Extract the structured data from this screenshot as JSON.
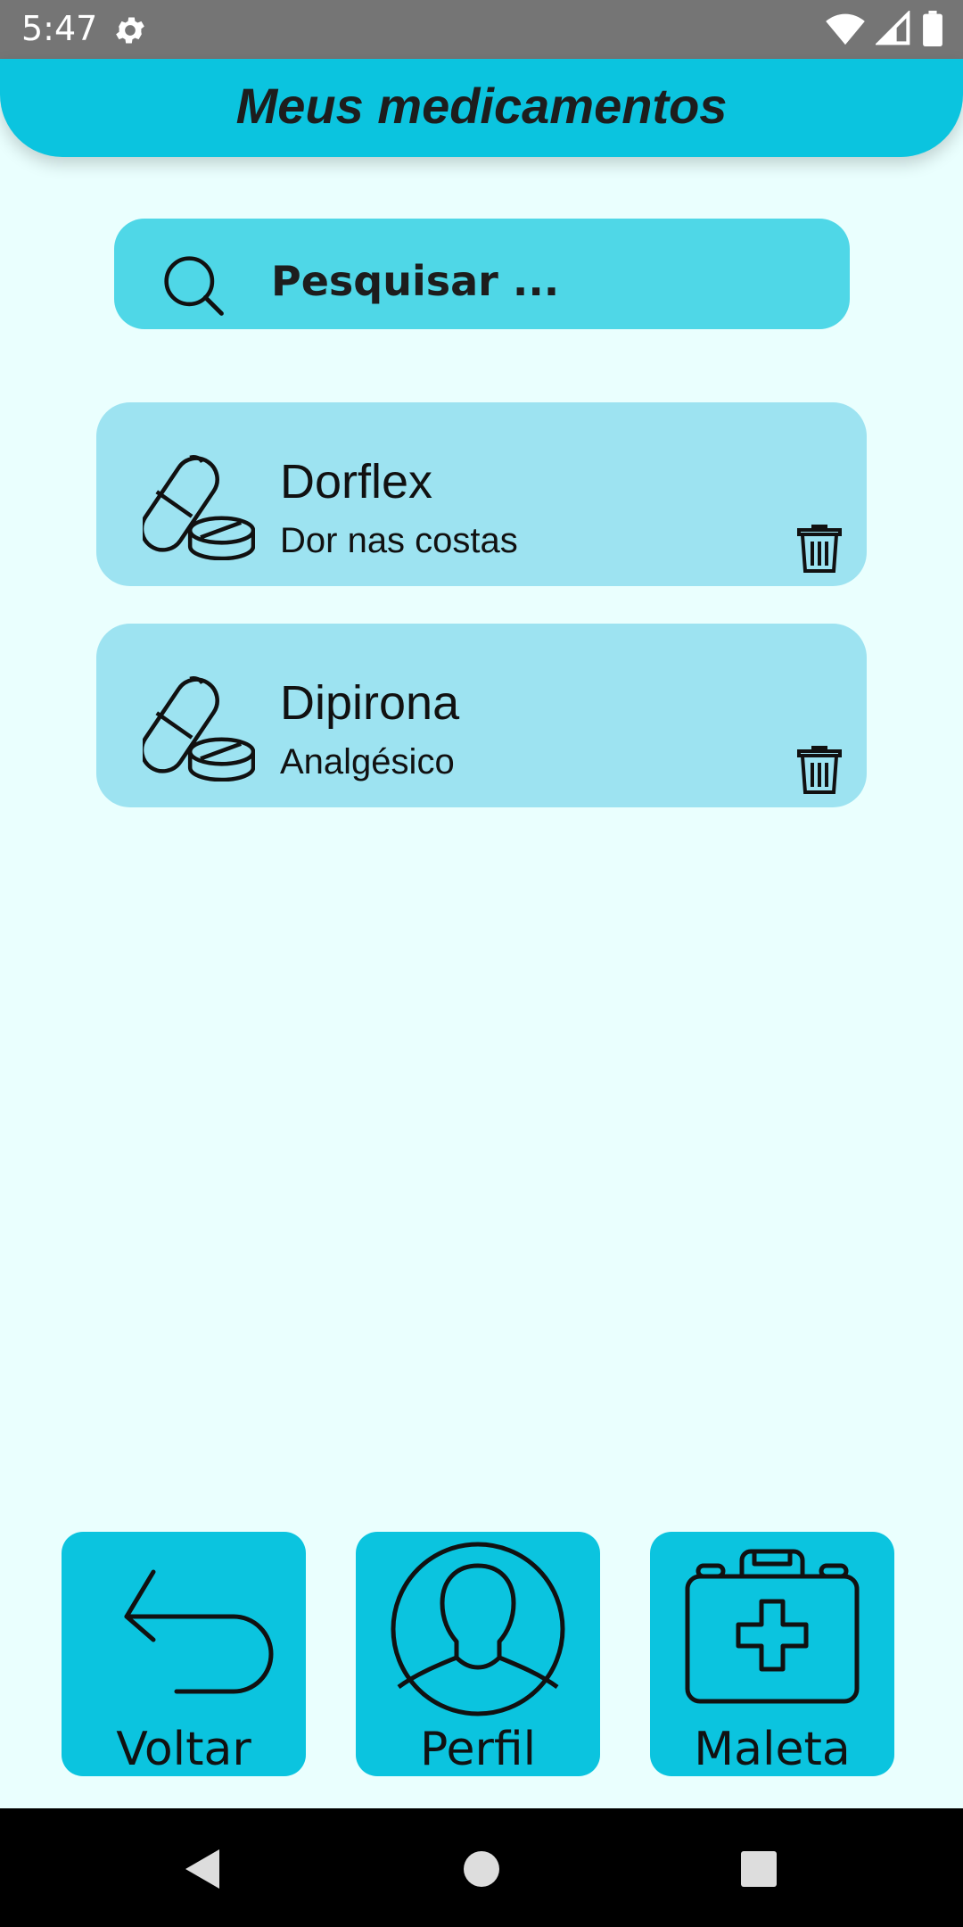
{
  "status_bar": {
    "time": "5:47"
  },
  "app_bar": {
    "title": "Meus medicamentos"
  },
  "search": {
    "placeholder": "Pesquisar ..."
  },
  "medications": [
    {
      "name": "Dorflex",
      "description": "Dor nas costas"
    },
    {
      "name": "Dipirona",
      "description": "Analgésico"
    }
  ],
  "bottom_nav": {
    "back_label": "Voltar",
    "profile_label": "Perfil",
    "kit_label": "Maleta"
  },
  "colors": {
    "background": "#eafffe",
    "accent": "#0bc4df",
    "search_bg": "#4fd7e7",
    "card_bg": "#9de3f1",
    "status_bar": "#757575"
  },
  "icons": {
    "status": [
      "gear-icon",
      "wifi-icon",
      "signal-icon",
      "battery-icon"
    ],
    "search": "search-icon",
    "medication": "pill-icon",
    "delete": "trash-icon",
    "nav": [
      "back-arrow-icon",
      "profile-icon",
      "medical-kit-icon"
    ],
    "system": [
      "nav-back-icon",
      "nav-home-icon",
      "nav-recents-icon"
    ]
  }
}
